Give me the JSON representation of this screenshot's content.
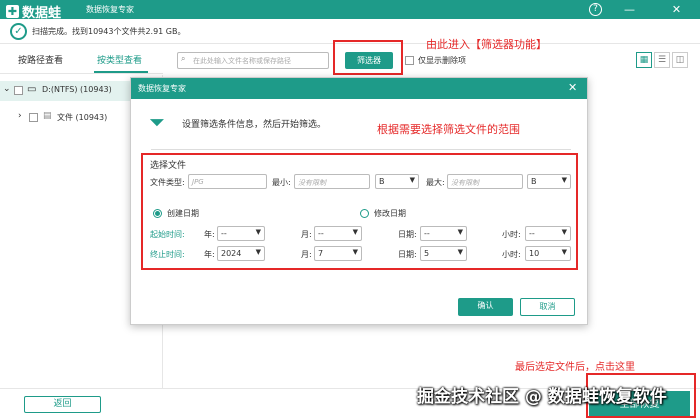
{
  "app": {
    "logo_text": "数据蛙",
    "title": "数据恢复专家",
    "help_icon": "?",
    "min_icon": "—",
    "close_icon": "✕"
  },
  "status": {
    "text": "扫描完成。找到10943个文件共2.91 GB。"
  },
  "sidebar": {
    "tabs": [
      "按路径查看",
      "按类型查看"
    ],
    "drive": "D:(NTFS) (10943)",
    "folder": "文件 (10943)"
  },
  "toolbar": {
    "search_placeholder": "在此处输入文件名称或保存路径",
    "filter_button": "筛选器",
    "show_deleted_label": "仅显示删除项"
  },
  "annotations": {
    "top": "由此进入【筛选器功能】",
    "middle": "根据需要选择筛选文件的范围",
    "bottom": "最后选定文件后，点击这里"
  },
  "dialog": {
    "title": "数据恢复专家",
    "close_icon": "✕",
    "instruction": "设置筛选条件信息，然后开始筛选。",
    "section_label": "选择文件",
    "file_type_label": "文件类型:",
    "file_type_placeholder": "JPG",
    "min_label": "最小:",
    "min_placeholder": "没有限制",
    "min_unit": "B",
    "max_label": "最大:",
    "max_placeholder": "没有限制",
    "max_unit": "B",
    "create_date_label": "创建日期",
    "modify_date_label": "修改日期",
    "start_label": "起始时间:",
    "end_label": "终止时间:",
    "year_label": "年:",
    "month_label": "月:",
    "day_label": "日期:",
    "hour_label": "小时:",
    "start_year": "--",
    "start_month": "--",
    "start_day": "--",
    "start_hour": "--",
    "end_year": "2024",
    "end_month": "7",
    "end_day": "5",
    "end_hour": "10",
    "ok_button": "确认",
    "cancel_button": "取消"
  },
  "footer": {
    "back_button": "返回",
    "recover_button": "全部恢复"
  },
  "watermark": "掘金技术社区 @ 数据蛙恢复软件"
}
